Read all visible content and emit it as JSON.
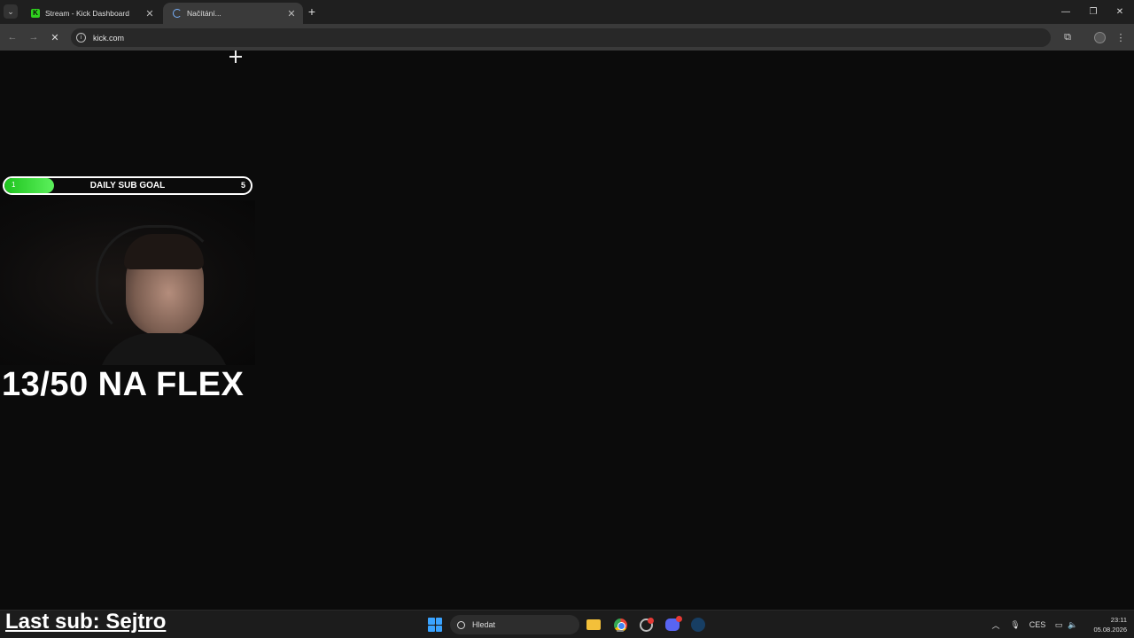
{
  "browser": {
    "tabs": [
      {
        "title": "Stream - Kick Dashboard",
        "favicon": "kick-icon",
        "active": false
      },
      {
        "title": "Načítání...",
        "favicon": "loading-spinner-icon",
        "active": true
      }
    ],
    "address": "kick.com"
  },
  "overlay": {
    "sub_goal": {
      "label": "DAILY SUB GOAL",
      "current": "1",
      "target": "5",
      "progress": 0.2,
      "accent_color": "#2fd21e"
    },
    "headline": "13/50 NA FLEX",
    "last_sub": "Last sub: Sejtro"
  },
  "taskbar": {
    "search_placeholder": "Hledat",
    "language": "CES",
    "time": "23:11",
    "date": "05.08.2026"
  }
}
